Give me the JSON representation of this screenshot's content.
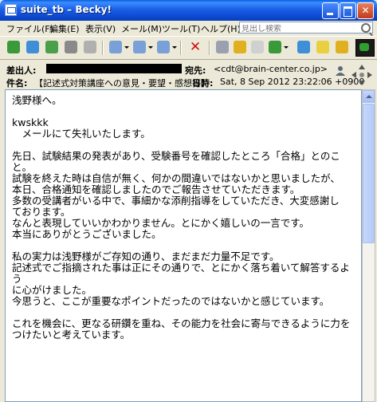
{
  "window": {
    "title": "suite_tb – Becky!"
  },
  "menu": {
    "items": [
      "ファイル(F)",
      "編集(E)",
      "表示(V)",
      "メール(M)",
      "ツール(T)",
      "ヘルプ(H)"
    ],
    "search_placeholder": "見出し検索"
  },
  "header": {
    "from_label": "差出人:",
    "from_value": "",
    "to_label": "宛先:",
    "to_value": "<cdt@brain-center.co.jp>",
    "subject_label": "件名:",
    "subject_value": "【記述式対策講座への意見・要望・感想等】",
    "date_label": "日時:",
    "date_value": "Sat, 8 Sep 2012 23:22:06 +0900"
  },
  "body": {
    "text": "浅野様へ。\n\nkwskkk\n　メールにて失礼いたします。\n\n先日、試験結果の発表があり、受験番号を確認したところ「合格」とのこと。\n試験を終えた時は自信が無く、何かの間違いではないかと思いましたが、\n本日、合格通知を確認しましたのでご報告させていただきます。\n多数の受講者がいる中で、事細かな添削指導をしていただき、大変感謝し\nております。\nなんと表現していいかわかりません。とにかく嬉しいの一言です。\n本当にありがとうございました。\n\n私の実力は浅野様がご存知の通り、まだまだ力量不足です。\n記述式でご指摘された事は正にその通りで、とにかく落ち着いて解答するよう\nに心がけました。\n今思うと、ここが重要なポイントだったのではないかと感じています。\n\nこれを機会に、更なる研鑽を重ね、その能力を社会に寄与できるように力を\nつけたいと考えています。"
  },
  "colors": {
    "titlebar": "#0a5fe0",
    "chrome": "#ece9d8"
  }
}
